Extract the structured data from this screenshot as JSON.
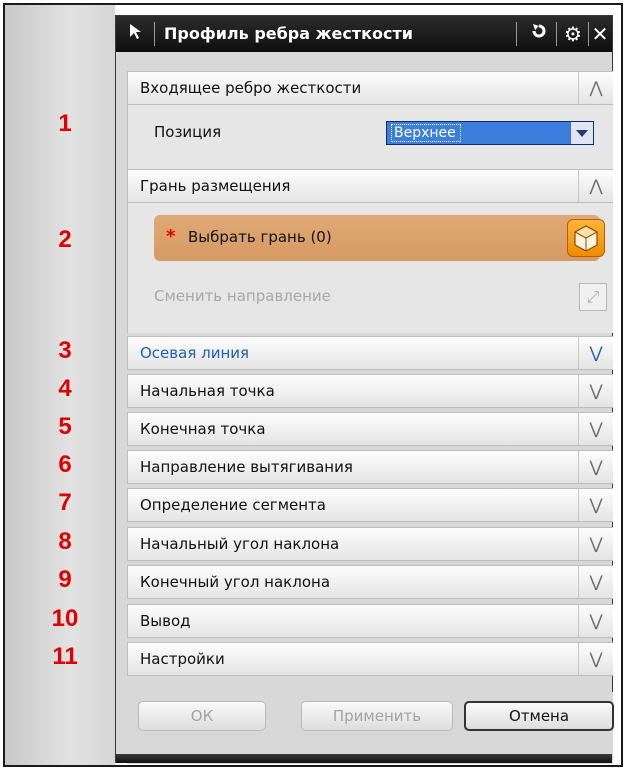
{
  "annotations": [
    "1",
    "2",
    "3",
    "4",
    "5",
    "6",
    "7",
    "8",
    "9",
    "10",
    "11"
  ],
  "dialog": {
    "title": "Профиль ребра жесткости",
    "icons": {
      "select": "select-arrow-icon",
      "reset": "reset-icon",
      "settings": "gear-icon",
      "close": "close-icon"
    }
  },
  "sections": {
    "incoming": {
      "title": "Входящее ребро жесткости",
      "position_label": "Позиция",
      "position_value": "Верхнее"
    },
    "placement": {
      "title": "Грань размещения",
      "select_face": "Выбрать грань (0)",
      "change_direction": "Сменить направление"
    },
    "collapsed": [
      "Осевая линия",
      "Начальная точка",
      "Конечная точка",
      "Направление вытягивания",
      "Определение сегмента",
      "Начальный угол наклона",
      "Конечный угол наклона",
      "Вывод",
      "Настройки"
    ]
  },
  "buttons": {
    "ok": "ОК",
    "apply": "Применить",
    "cancel": "Отмена"
  },
  "colors": {
    "accent": "#3b7ede",
    "highlight_section": "#1f5fb4",
    "required": "#e40000",
    "annotation": "#e00000"
  }
}
